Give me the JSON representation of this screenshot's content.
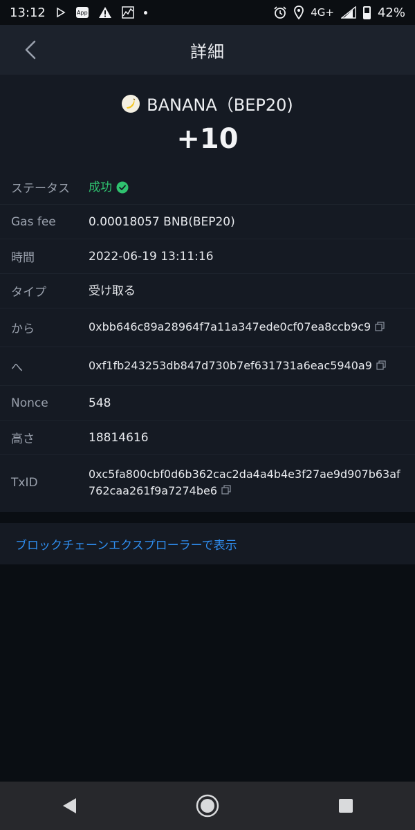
{
  "status_bar": {
    "time": "13:12",
    "app_badge": "App",
    "network": "4G+",
    "battery": "42%",
    "battery_level": 0.42
  },
  "header": {
    "title": "詳細"
  },
  "token": {
    "name": "BANANA（BEP20)",
    "amount": "+10"
  },
  "details": {
    "status": {
      "label": "ステータス",
      "value": "成功"
    },
    "gas_fee": {
      "label": "Gas fee",
      "value": "0.00018057 BNB(BEP20)"
    },
    "time": {
      "label": "時間",
      "value": "2022-06-19 13:11:16"
    },
    "type": {
      "label": "タイプ",
      "value": "受け取る"
    },
    "from": {
      "label": "から",
      "value": "0xbb646c89a28964f7a11a347ede0cf07ea8ccb9c9"
    },
    "to": {
      "label": "へ",
      "value": "0xf1fb243253db847d730b7ef631731a6eac5940a9"
    },
    "nonce": {
      "label": "Nonce",
      "value": "548"
    },
    "height": {
      "label": "高さ",
      "value": "18814616"
    },
    "txid": {
      "label": "TxID",
      "value": "0xc5fa800cbf0d6b362cac2da4a4b4e3f27ae9d907b63af762caa261f9a7274be6"
    }
  },
  "explorer": {
    "label": "ブロックチェーンエクスプローラーで表示"
  },
  "colors": {
    "success": "#2fc26f",
    "link": "#2f8ef0",
    "header_bg": "#1c222c",
    "card_bg": "#151a23"
  }
}
